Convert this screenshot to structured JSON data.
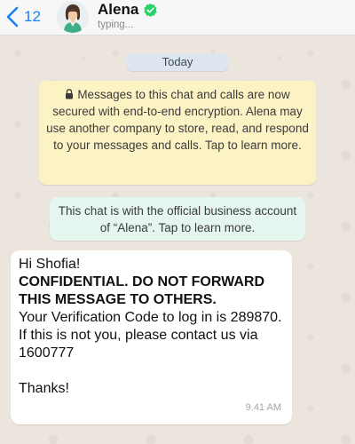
{
  "header": {
    "back_count": "12",
    "contact_name": "Alena",
    "status": "typing..."
  },
  "chat": {
    "date_label": "Today",
    "encryption_notice": "Messages to this chat and calls are now secured with end-to-end encryption. Alena may use another company to store, read, and respond to your messages and calls. Tap to learn more.",
    "business_notice": "This chat is with the official business account of “Alena”. Tap to learn more.",
    "message": {
      "greeting": "Hi Shofia!",
      "warning": "CONFIDENTIAL. DO NOT FORWARD THIS MESSAGE TO OTHERS.",
      "body": "Your Verification Code to log in is 289870. If this is not you, please contact us via 1600777",
      "closing": "Thanks!",
      "time": "9.41 AM"
    }
  },
  "colors": {
    "accent": "#1a7ef5",
    "verified": "#25d366",
    "encryption_bg": "#fcf3c4",
    "business_bg": "#e5f6ef",
    "wallpaper": "#ece5dd"
  },
  "icons": {
    "back": "chevron-left-icon",
    "verified": "verified-badge-icon",
    "lock": "lock-icon"
  }
}
